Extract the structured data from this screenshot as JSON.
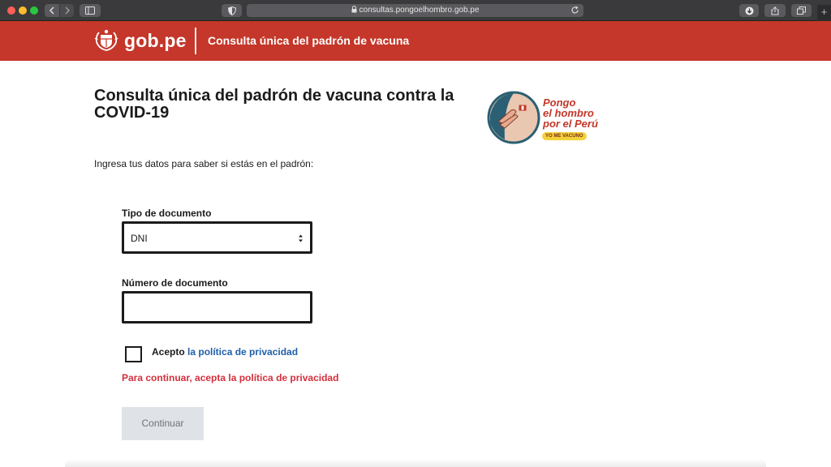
{
  "browser": {
    "url": "consultas.pongoelhombro.gob.pe",
    "new_tab_symbol": "+"
  },
  "header": {
    "brand": "gob.pe",
    "title": "Consulta única del padrón de vacuna",
    "color": "#c4372a"
  },
  "main": {
    "heading": "Consulta única del padrón de vacuna contra la COVID-19",
    "intro": "Ingresa tus datos para saber si estás en el padrón:",
    "logo": {
      "line1": "Pongo",
      "line2": "el hombro",
      "line3": "por el Perú",
      "badge": "YO ME VACUNO"
    },
    "form": {
      "doc_type_label": "Tipo de documento",
      "doc_type_value": "DNI",
      "doc_number_label": "Número de documento",
      "doc_number_value": "",
      "accept_prefix": "Acepto",
      "accept_link": "la política de privacidad",
      "error": "Para continuar, acepta la política de privacidad",
      "submit_label": "Continuar"
    }
  },
  "colors": {
    "link": "#1f5fa8",
    "error": "#d32f3d",
    "button_disabled": "#dfe3e8"
  }
}
